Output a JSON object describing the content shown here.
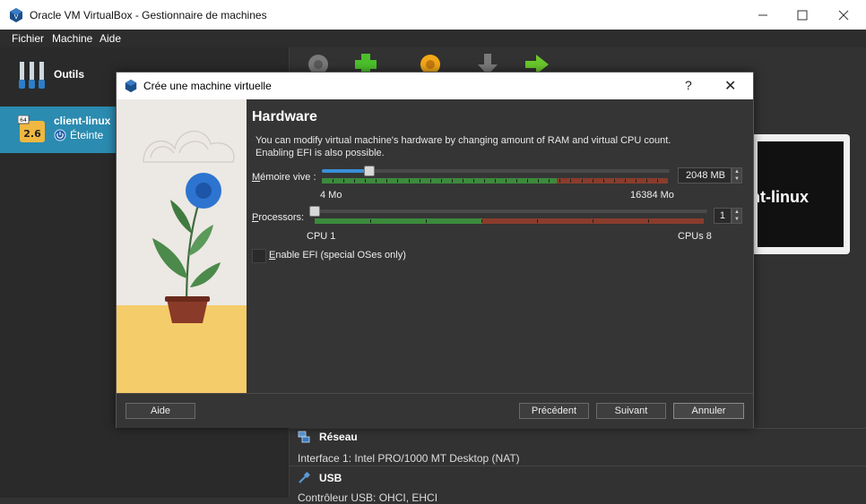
{
  "window": {
    "title": "Oracle VM VirtualBox - Gestionnaire de machines"
  },
  "menu": [
    "Fichier",
    "Machine",
    "Aide"
  ],
  "left": {
    "tools_label": "Outils",
    "vm": {
      "name": "client-linux",
      "state": "Éteinte",
      "badge_top": "64",
      "badge_version": "2.6"
    }
  },
  "preview": {
    "text": "client-linux"
  },
  "details": {
    "network_title": "Réseau",
    "network_line": "Interface 1:   Intel PRO/1000 MT Desktop (NAT)",
    "usb_title": "USB",
    "usb_line": "Contrôleur USB:          OHCI, EHCI"
  },
  "dialog": {
    "title": "Crée une machine virtuelle",
    "help": "?",
    "close": "✕",
    "heading": "Hardware",
    "description": "You can modify virtual machine's hardware by changing amount of RAM and virtual CPU count. Enabling EFI is also possible.",
    "memory": {
      "label": "Mémoire vive :",
      "value": "2048 MB",
      "min_label": "4 Mo",
      "max_label": "16384 Mo",
      "min": 4,
      "max": 16384,
      "current": 2048
    },
    "processors": {
      "label": "Processors:",
      "value": "1",
      "min_label": "CPU 1",
      "max_label": "CPUs 8",
      "min": 1,
      "max": 8,
      "current": 1
    },
    "efi": {
      "label": "Enable EFI (special OSes only)",
      "checked": false
    },
    "buttons": {
      "help": "Aide",
      "previous": "Précédent",
      "next": "Suivant",
      "cancel": "Annuler"
    }
  },
  "colors": {
    "accent": "#2b8bb0",
    "scale_green": "#3c8b3c",
    "scale_red": "#8a3c2c",
    "scale_orange": "#7a5a2a"
  }
}
